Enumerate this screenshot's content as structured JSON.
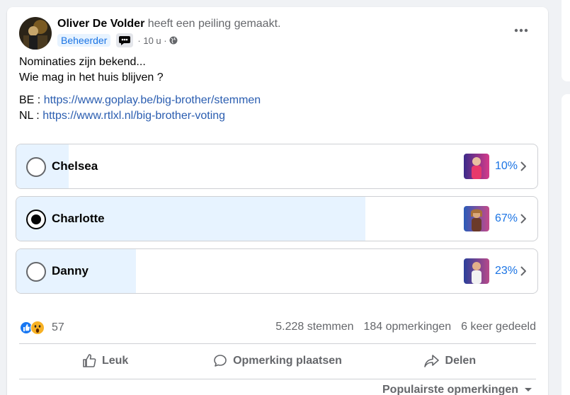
{
  "post": {
    "author": "Oliver De Volder",
    "action": "heeft een peiling gemaakt.",
    "role_badge": "Beheerder",
    "time": "10 u",
    "text_line1": "Nominaties zijn bekend...",
    "text_line2": "Wie mag in het huis blijven ?",
    "link1_prefix": "BE : ",
    "link1": "https://www.goplay.be/big-brother/stemmen",
    "link2_prefix": "NL : ",
    "link2": "https://www.rtlxl.nl/big-brother-voting"
  },
  "poll": {
    "options": [
      {
        "label": "Chelsea",
        "percent": "10%",
        "share": 0.1,
        "selected": false
      },
      {
        "label": "Charlotte",
        "percent": "67%",
        "share": 0.67,
        "selected": true
      },
      {
        "label": "Danny",
        "percent": "23%",
        "share": 0.23,
        "selected": false
      }
    ]
  },
  "stats": {
    "reaction_count": "57",
    "votes": "5.228 stemmen",
    "comments": "184 opmerkingen",
    "shares": "6 keer gedeeld"
  },
  "actions": {
    "like": "Leuk",
    "comment": "Opmerking plaatsen",
    "share": "Delen"
  },
  "comments_sort": "Populairste opmerkingen",
  "colors": {
    "accent": "#1b74e4",
    "poll_fill": "#e7f3ff",
    "muted_text": "#65676b"
  },
  "icons": {
    "more": "more-horizontal-icon",
    "globe": "globe-icon",
    "chevron": "chevron-right-icon",
    "like": "thumbs-up-icon",
    "comment": "speech-bubble-icon",
    "share": "share-arrow-icon",
    "sort": "caret-down-icon"
  }
}
